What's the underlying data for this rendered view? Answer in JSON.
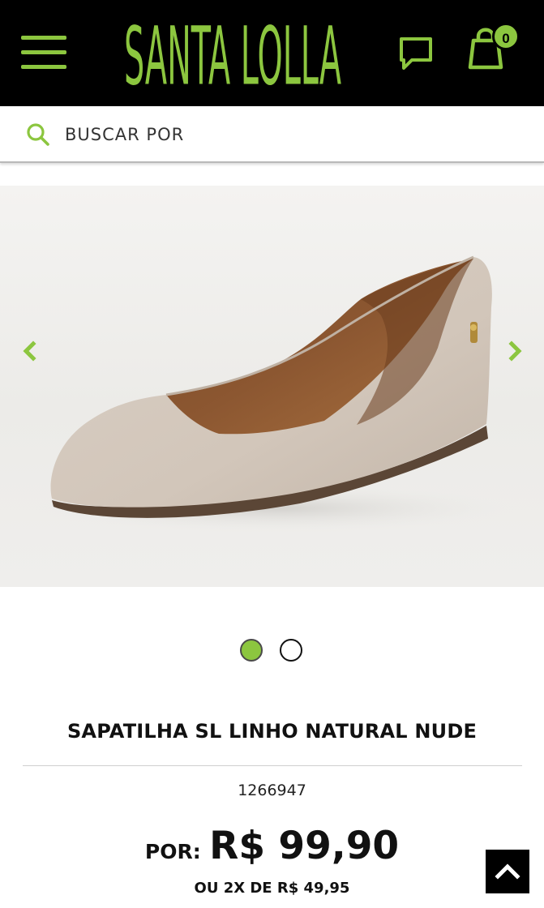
{
  "header": {
    "brand": "SANTA LOLLA",
    "cart_count": "0",
    "accent_color": "#8cc63f",
    "background_color": "#000000",
    "icons": [
      "hamburger-menu-icon",
      "chat-icon",
      "shopping-bag-icon"
    ]
  },
  "search": {
    "placeholder": "BUSCAR POR",
    "icon": "search-icon"
  },
  "gallery": {
    "total_images": 2,
    "active_index": 1,
    "image_alt": "beige linen pointed flat shoe",
    "icons": [
      "chevron-left-icon",
      "chevron-right-icon"
    ]
  },
  "product": {
    "name": "SAPATILHA SL LINHO NATURAL NUDE",
    "sku": "1266947",
    "price_label": "POR:",
    "price": "R$ 99,90",
    "installments": "OU 2X DE R$ 49,95"
  },
  "back_to_top": {
    "icon": "chevron-up-icon"
  }
}
